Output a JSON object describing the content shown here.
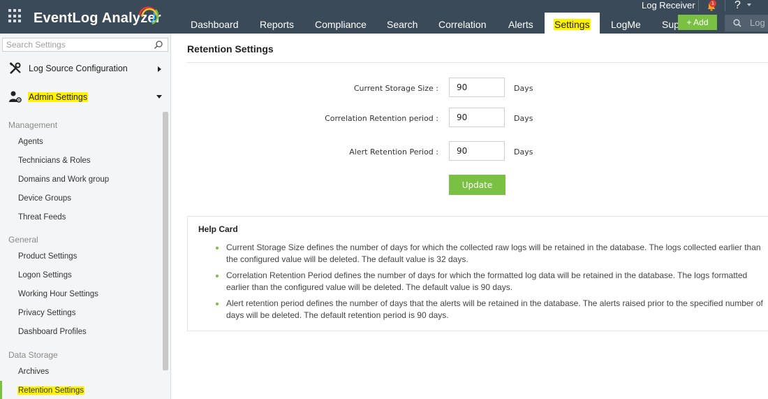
{
  "app": {
    "name": "EventLog Analyzer",
    "log_receiver": "Log Receiver",
    "notifications_count": "1",
    "help_label": "?"
  },
  "nav": {
    "tabs": [
      {
        "label": "Dashboard",
        "active": false
      },
      {
        "label": "Reports",
        "active": false
      },
      {
        "label": "Compliance",
        "active": false
      },
      {
        "label": "Search",
        "active": false
      },
      {
        "label": "Correlation",
        "active": false
      },
      {
        "label": "Alerts",
        "active": false
      },
      {
        "label": "Settings",
        "active": true
      },
      {
        "label": "LogMe",
        "active": false
      },
      {
        "label": "Sup",
        "active": false
      }
    ],
    "add_label": "+ Add",
    "search_placeholder": "Log"
  },
  "sidebar": {
    "search_placeholder": "Search Settings",
    "sections": [
      {
        "label": "Log Source Configuration",
        "icon": "tools-icon",
        "expanded": false
      },
      {
        "label": "Admin Settings",
        "icon": "admin-user-gear-icon",
        "expanded": true
      }
    ],
    "groups": [
      {
        "title": "Management",
        "items": [
          "Agents",
          "Technicians & Roles",
          "Domains and Work group",
          "Device Groups",
          "Threat Feeds"
        ]
      },
      {
        "title": "General",
        "items": [
          "Product Settings",
          "Logon Settings",
          "Working Hour Settings",
          "Privacy Settings",
          "Dashboard Profiles"
        ]
      },
      {
        "title": "Data Storage",
        "items": [
          "Archives",
          "Retention Settings"
        ]
      }
    ],
    "active_item": "Retention Settings"
  },
  "main": {
    "title": "Retention Settings",
    "fields": [
      {
        "label": "Current Storage Size :",
        "value": "90",
        "unit": "Days"
      },
      {
        "label": "Correlation Retention period :",
        "value": "90",
        "unit": "Days"
      },
      {
        "label": "Alert Retention Period :",
        "value": "90",
        "unit": "Days"
      }
    ],
    "update_label": "Update",
    "help_card": {
      "title": "Help Card",
      "items": [
        "Current Storage Size defines the number of days for which the collected raw logs will be retained in the database. The logs collected earlier than the configured value will be deleted. The default value is 32 days.",
        "Correlation Retention Period defines the number of days for which the formatted log data will be retained in the database. The logs formatted earlier than the configured value will be deleted. The default value is 90 days.",
        "Alert retention period defines the number of days that the alerts will be retained in the database. The alerts raised prior to the specified number of days will be deleted. The default retention period is 90 days."
      ]
    }
  },
  "colors": {
    "topbar": "#3b4a58",
    "accent_green": "#7ac143",
    "highlight": "#fff200"
  }
}
